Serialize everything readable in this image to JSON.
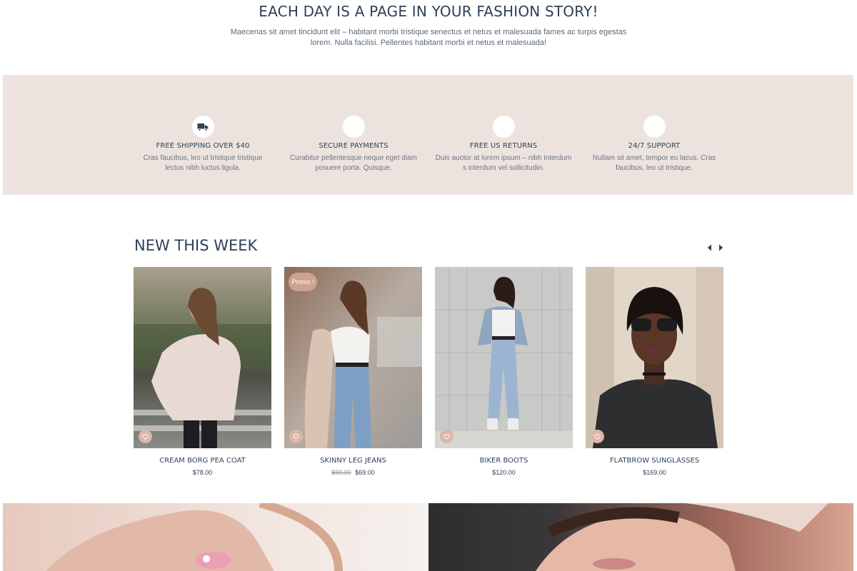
{
  "hero": {
    "title": "EACH DAY IS A PAGE IN YOUR FASHION STORY!",
    "text_line1": "Maecenas sit amet tincidunt elit – habitant morbi tristique senectus et netus et malesuada fames ac turpis egestas",
    "text_line2": "lorem. Nulla facilisi. Pellentes habitant morbi et netus et malesuada!"
  },
  "features": [
    {
      "icon": "truck-icon",
      "title": "FREE SHIPPING OVER $40",
      "line1": "Cras faucibus, leo ut tristique tristique",
      "line2": "lectus nibh luctus ligula."
    },
    {
      "icon": "secure-payment-icon",
      "title": "SECURE PAYMENTS",
      "line1": "Curabitur pellentesque neque eget diam",
      "line2": "posuere porta. Quisque."
    },
    {
      "icon": "returns-icon",
      "title": "FREE US RETURNS",
      "line1": "Duis auctor at lorem ipsum – nibh interdum",
      "line2": "s interdum vel sollicitudin."
    },
    {
      "icon": "support-icon",
      "title": "24/7 SUPPORT",
      "line1": "Nullam sit amet, tempor eu lacus. Cras",
      "line2": "faucibus, leo ut tristique."
    }
  ],
  "new_this_week": {
    "title": "NEW THIS WEEK",
    "products": [
      {
        "name": "CREAM BORG PEA COAT",
        "price": "$78.00",
        "old_price": "",
        "badge": ""
      },
      {
        "name": "SKINNY LEG JEANS",
        "price": "$69.00",
        "old_price": "$90.00",
        "badge": "Promo !"
      },
      {
        "name": "BIKER BOOTS",
        "price": "$120.00",
        "old_price": "",
        "badge": ""
      },
      {
        "name": "FLATBROW SUNGLASSES",
        "price": "$169.00",
        "old_price": "",
        "badge": ""
      }
    ]
  },
  "colors": {
    "band_background": "#ede3de",
    "heading": "#2f4156",
    "accent": "#dcb6a7"
  }
}
